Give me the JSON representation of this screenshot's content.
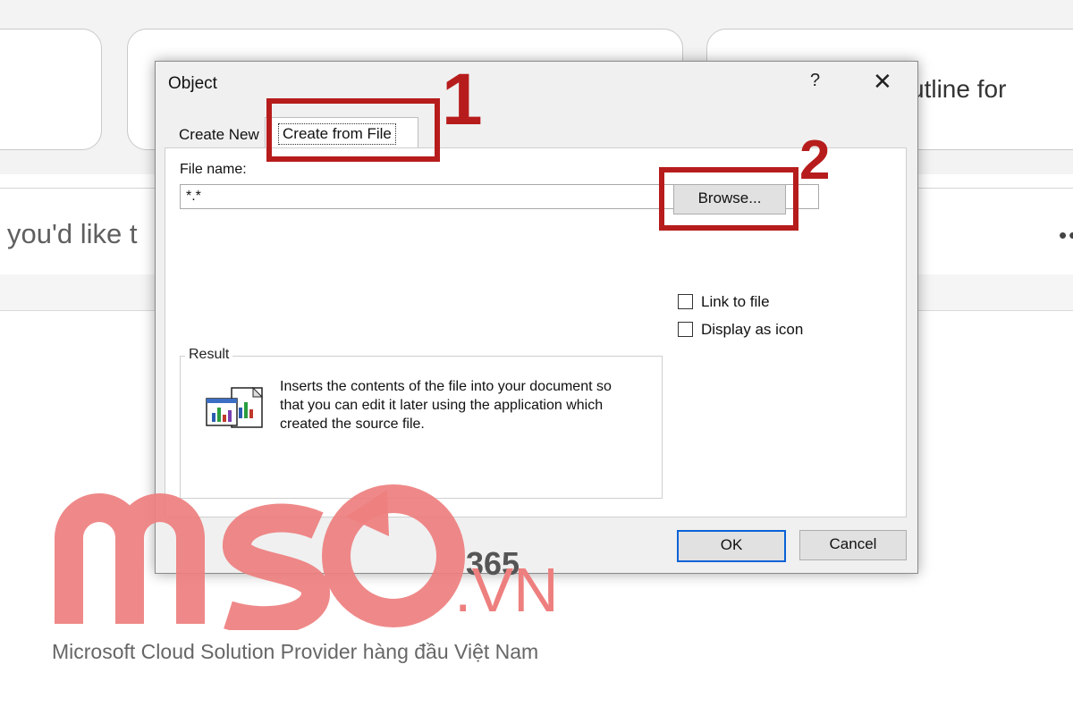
{
  "background": {
    "card_right_text": "utline for",
    "prompt_text": "you'd like t",
    "more_label": "••"
  },
  "dialog": {
    "title": "Object",
    "help_label": "?",
    "close_label": "✕",
    "tabs": [
      {
        "label": "Create New"
      },
      {
        "label": "Create from File",
        "selected": true
      }
    ],
    "file_name_label": "File name:",
    "file_name_value": "*.*",
    "browse_label": "Browse...",
    "link_to_file_label": "Link to file",
    "display_as_icon_label": "Display as icon",
    "link_to_file_checked": false,
    "display_as_icon_checked": false,
    "result_label": "Result",
    "result_text": "Inserts the contents of the file into your document so that you can edit it later using the application which created the source file.",
    "result_icon": "object-file-icon",
    "ok_label": "OK",
    "cancel_label": "Cancel"
  },
  "annotations": {
    "step1": "1",
    "step2": "2",
    "color": "#b71c1c"
  },
  "watermark": {
    "logo_text": "MSO",
    "suffix": ".VN",
    "number": "365",
    "tagline": "Microsoft Cloud Solution Provider hàng đầu Việt Nam",
    "color": "#ee7f7f"
  }
}
